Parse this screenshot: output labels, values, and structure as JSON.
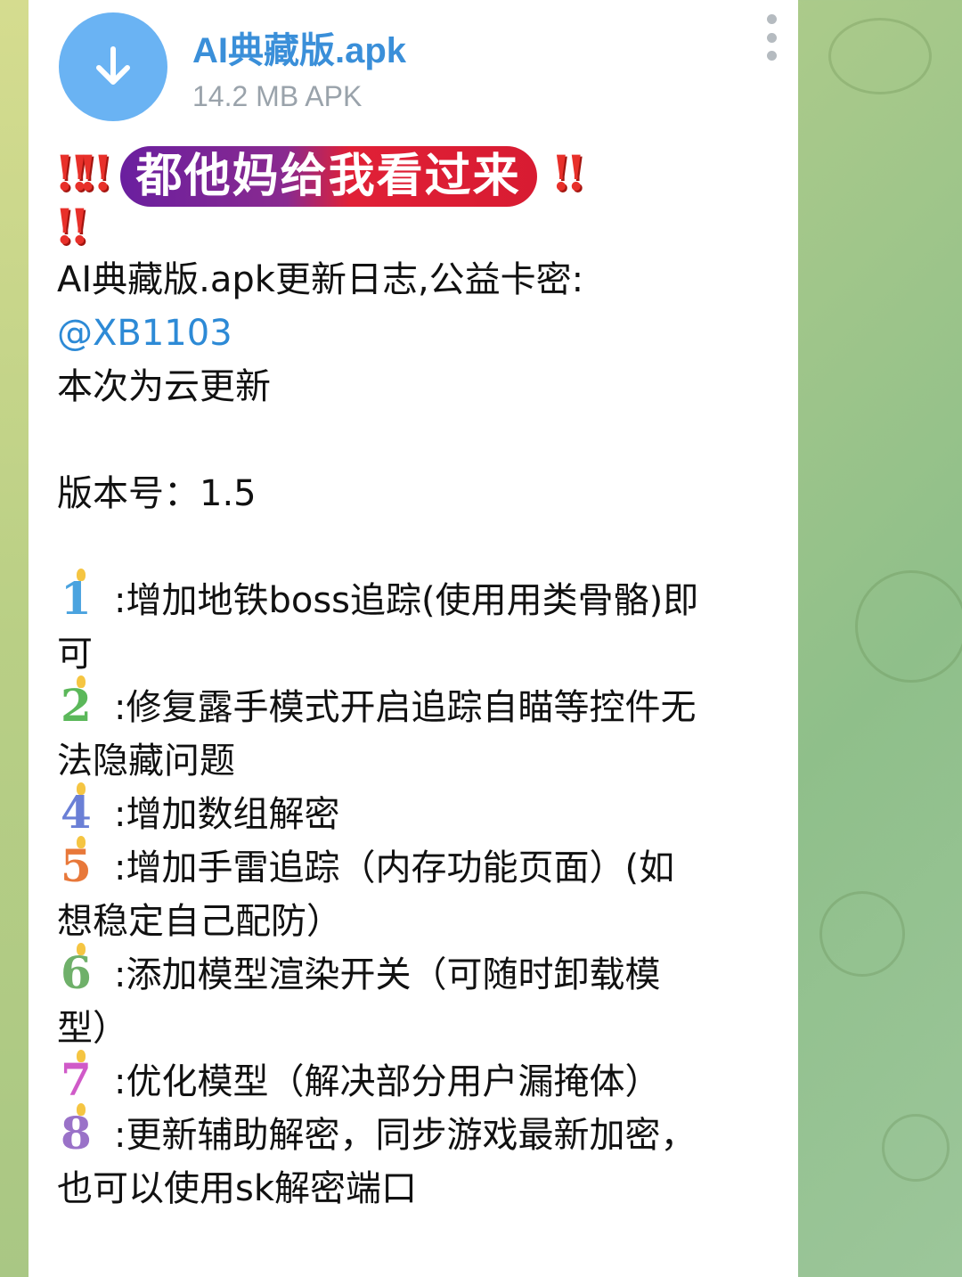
{
  "file": {
    "name": "AI典藏版.apk",
    "meta": "14.2 MB APK"
  },
  "banner": {
    "text": "都他妈给我看过来",
    "bang_left": "‼‼",
    "bang_right": "‼",
    "bang_wrap": "‼"
  },
  "message": {
    "line1": "AI典藏版.apk更新日志,公益卡密:",
    "mention": "@XB1103",
    "line3": "本次为云更新",
    "version": "版本号：1.5",
    "items": [
      {
        "icon": "1",
        "icon_color": "#4aa3df",
        "text": ":增加地铁boss追踪(使用用类骨骼)即",
        "wrap": "可"
      },
      {
        "icon": "2",
        "icon_color": "#5bb85a",
        "text": ":修复露手模式开启追踪自瞄等控件无",
        "wrap": "法隐藏问题"
      },
      {
        "icon": "4",
        "icon_color": "#6a7fd6",
        "text": ":增加数组解密",
        "wrap": ""
      },
      {
        "icon": "5",
        "icon_color": "#e8783a",
        "text": ":增加手雷追踪（内存功能页面）(如",
        "wrap": "想稳定自己配防）"
      },
      {
        "icon": "6",
        "icon_color": "#6fb06a",
        "text": ":添加模型渲染开关（可随时卸载模",
        "wrap": "型）"
      },
      {
        "icon": "7",
        "icon_color": "#d05ac8",
        "text": ":优化模型（解决部分用户漏掩体）",
        "wrap": ""
      },
      {
        "icon": "8",
        "icon_color": "#9a72c8",
        "text": ":更新辅助解密，同步游戏最新加密，",
        "wrap": "也可以使用sk解密端口"
      }
    ]
  }
}
